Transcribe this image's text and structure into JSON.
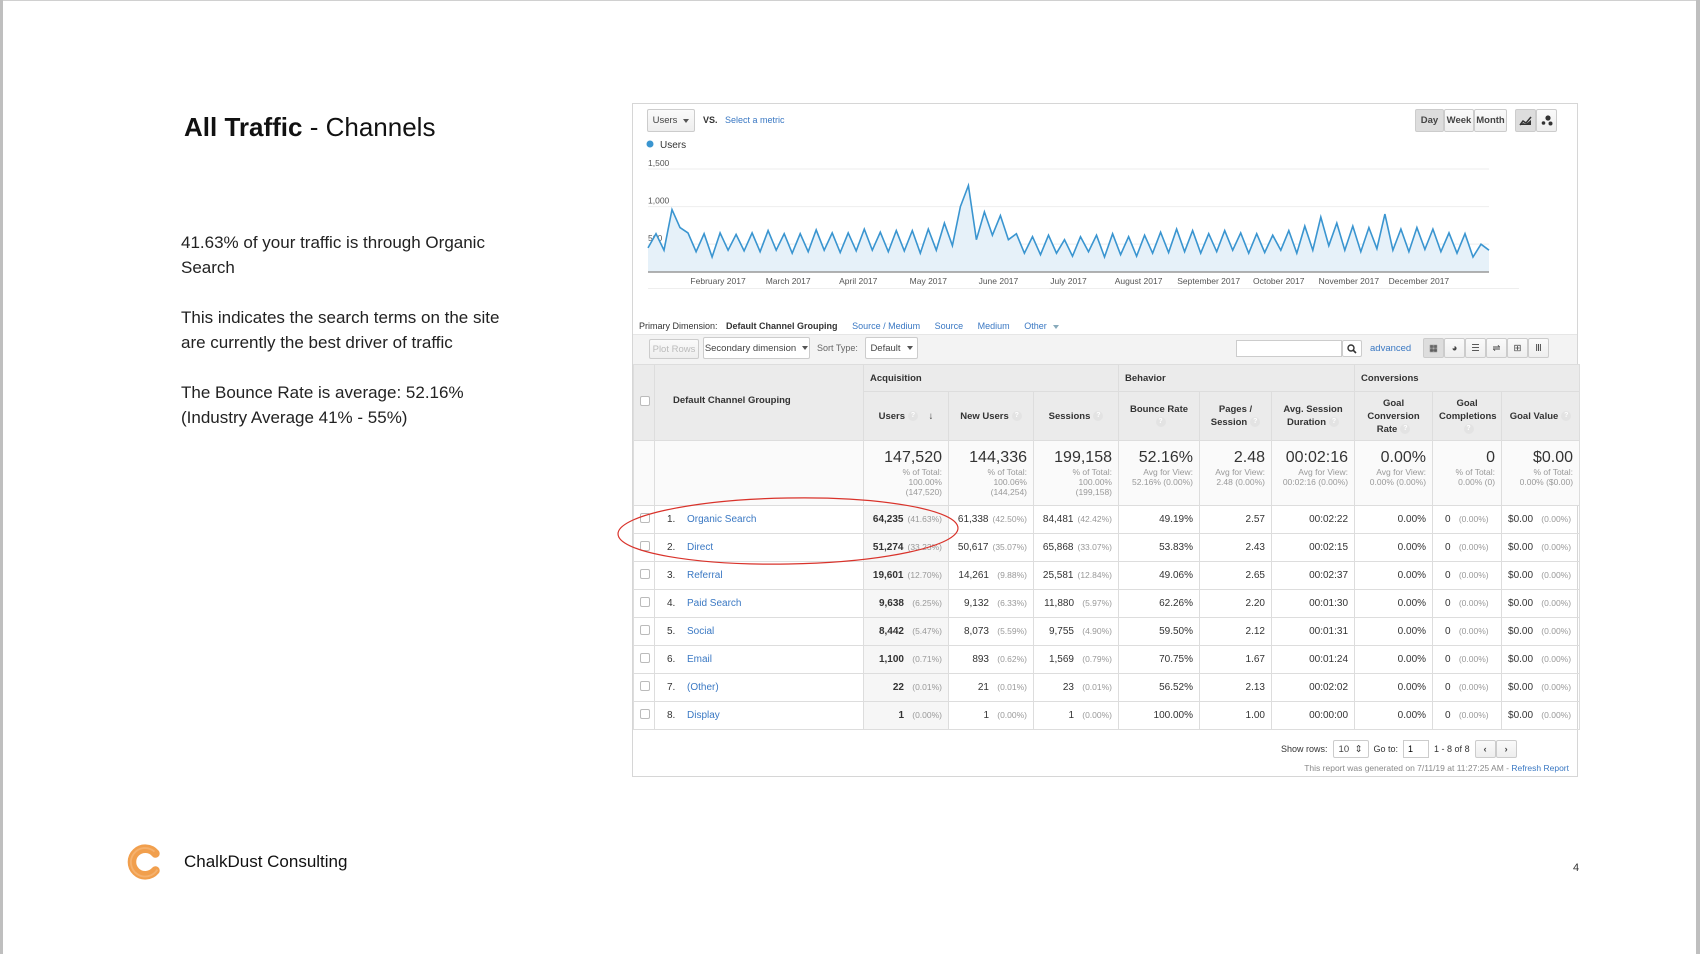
{
  "slide": {
    "title_bold": "All Traffic",
    "title_rest": " - Channels",
    "paragraphs": [
      "41.63% of your traffic is through Organic Search",
      "This indicates the search terms on the site are currently the best driver of traffic",
      "The Bounce Rate is average: 52.16% (Industry Average 41% - 55%)"
    ],
    "brand": "ChalkDust Consulting",
    "page_number": "4",
    "logo_color": "#f0953a",
    "annotation_color": "#d9332b"
  },
  "report": {
    "metric_select": "Users",
    "vs": "VS.",
    "select_metric": "Select a metric",
    "period_buttons": [
      "Day",
      "Week",
      "Month"
    ],
    "active_period": "Day",
    "chart_type_icons": [
      "line-chart-icon",
      "motion-chart-icon"
    ],
    "primary_dimension_label": "Primary Dimension:",
    "primary_dimension": "Default Channel Grouping",
    "dimension_links": [
      "Source / Medium",
      "Source",
      "Medium",
      "Other"
    ],
    "plot_rows": "Plot Rows",
    "secondary_dimension": "Secondary dimension",
    "sort_type_label": "Sort Type:",
    "sort_type": "Default",
    "search_value": "",
    "advanced": "advanced",
    "view_icons": [
      "grid-icon",
      "pie-icon",
      "bar-icon",
      "compare-icon",
      "pivot-icon",
      "term-cloud-icon"
    ],
    "show_rows_label": "Show rows:",
    "show_rows": "10",
    "goto_label": "Go to:",
    "goto_value": "1",
    "range": "1 - 8 of 8",
    "generated": "This report was generated on 7/11/19 at 11:27:25 AM - ",
    "refresh": "Refresh Report",
    "accent": "#3a78c3"
  },
  "chart_data": {
    "type": "area",
    "legend": [
      "Users"
    ],
    "series_color": "#3a95d0",
    "yticks": [
      "1,500",
      "1,000",
      "500"
    ],
    "ytick_values": [
      1500,
      1000,
      500
    ],
    "ylim": [
      130,
      1500
    ],
    "xticks": [
      "February 2017",
      "March 2017",
      "April 2017",
      "May 2017",
      "June 2017",
      "July 2017",
      "August 2017",
      "September 2017",
      "October 2017",
      "November 2017",
      "December 2017"
    ],
    "values": [
      450,
      640,
      420,
      960,
      720,
      650,
      400,
      640,
      330,
      650,
      420,
      630,
      410,
      650,
      400,
      680,
      420,
      640,
      380,
      640,
      400,
      690,
      420,
      650,
      390,
      650,
      410,
      700,
      420,
      660,
      400,
      680,
      410,
      680,
      380,
      700,
      420,
      780,
      480,
      1000,
      1280,
      560,
      930,
      620,
      880,
      560,
      640,
      380,
      600,
      360,
      620,
      380,
      560,
      340,
      600,
      400,
      620,
      330,
      640,
      360,
      600,
      340,
      620,
      380,
      660,
      390,
      700,
      400,
      680,
      380,
      640,
      400,
      680,
      420,
      650,
      380,
      640,
      390,
      620,
      420,
      680,
      380,
      740,
      420,
      860,
      480,
      780,
      420,
      740,
      400,
      720,
      440,
      900,
      420,
      700,
      400,
      720,
      430,
      700,
      400,
      650,
      380,
      640,
      330,
      500,
      420
    ]
  },
  "table": {
    "dimension_header": "Default Channel Grouping",
    "groups": [
      "Acquisition",
      "Behavior",
      "Conversions"
    ],
    "columns": [
      "Users",
      "New Users",
      "Sessions",
      "Bounce Rate",
      "Pages / Session",
      "Avg. Session Duration",
      "Goal Conversion Rate",
      "Goal Completions",
      "Goal Value"
    ],
    "totals": [
      {
        "value": "147,520",
        "l1": "% of Total:",
        "l2": "100.00%",
        "l3": "(147,520)"
      },
      {
        "value": "144,336",
        "l1": "% of Total:",
        "l2": "100.06%",
        "l3": "(144,254)"
      },
      {
        "value": "199,158",
        "l1": "% of Total:",
        "l2": "100.00%",
        "l3": "(199,158)"
      },
      {
        "value": "52.16%",
        "l1": "Avg for View:",
        "l2": "52.16% (0.00%)",
        "l3": ""
      },
      {
        "value": "2.48",
        "l1": "Avg for View:",
        "l2": "2.48 (0.00%)",
        "l3": ""
      },
      {
        "value": "00:02:16",
        "l1": "Avg for View:",
        "l2": "00:02:16 (0.00%)",
        "l3": ""
      },
      {
        "value": "0.00%",
        "l1": "Avg for View:",
        "l2": "0.00% (0.00%)",
        "l3": ""
      },
      {
        "value": "0",
        "l1": "% of Total:",
        "l2": "0.00% (0)",
        "l3": ""
      },
      {
        "value": "$0.00",
        "l1": "% of Total:",
        "l2": "0.00% ($0.00)",
        "l3": ""
      }
    ],
    "rows": [
      {
        "n": "1.",
        "name": "Organic Search",
        "users": "64,235",
        "users_pct": "(41.63%)",
        "new_users": "61,338",
        "new_users_pct": "(42.50%)",
        "sessions": "84,481",
        "sessions_pct": "(42.42%)",
        "bounce": "49.19%",
        "pages": "2.57",
        "duration": "00:02:22",
        "gcr": "0.00%",
        "gc": "0",
        "gc_pct": "(0.00%)",
        "gv": "$0.00",
        "gv_pct": "(0.00%)"
      },
      {
        "n": "2.",
        "name": "Direct",
        "users": "51,274",
        "users_pct": "(33.23%)",
        "new_users": "50,617",
        "new_users_pct": "(35.07%)",
        "sessions": "65,868",
        "sessions_pct": "(33.07%)",
        "bounce": "53.83%",
        "pages": "2.43",
        "duration": "00:02:15",
        "gcr": "0.00%",
        "gc": "0",
        "gc_pct": "(0.00%)",
        "gv": "$0.00",
        "gv_pct": "(0.00%)"
      },
      {
        "n": "3.",
        "name": "Referral",
        "users": "19,601",
        "users_pct": "(12.70%)",
        "new_users": "14,261",
        "new_users_pct": "(9.88%)",
        "sessions": "25,581",
        "sessions_pct": "(12.84%)",
        "bounce": "49.06%",
        "pages": "2.65",
        "duration": "00:02:37",
        "gcr": "0.00%",
        "gc": "0",
        "gc_pct": "(0.00%)",
        "gv": "$0.00",
        "gv_pct": "(0.00%)"
      },
      {
        "n": "4.",
        "name": "Paid Search",
        "users": "9,638",
        "users_pct": "(6.25%)",
        "new_users": "9,132",
        "new_users_pct": "(6.33%)",
        "sessions": "11,880",
        "sessions_pct": "(5.97%)",
        "bounce": "62.26%",
        "pages": "2.20",
        "duration": "00:01:30",
        "gcr": "0.00%",
        "gc": "0",
        "gc_pct": "(0.00%)",
        "gv": "$0.00",
        "gv_pct": "(0.00%)"
      },
      {
        "n": "5.",
        "name": "Social",
        "users": "8,442",
        "users_pct": "(5.47%)",
        "new_users": "8,073",
        "new_users_pct": "(5.59%)",
        "sessions": "9,755",
        "sessions_pct": "(4.90%)",
        "bounce": "59.50%",
        "pages": "2.12",
        "duration": "00:01:31",
        "gcr": "0.00%",
        "gc": "0",
        "gc_pct": "(0.00%)",
        "gv": "$0.00",
        "gv_pct": "(0.00%)"
      },
      {
        "n": "6.",
        "name": "Email",
        "users": "1,100",
        "users_pct": "(0.71%)",
        "new_users": "893",
        "new_users_pct": "(0.62%)",
        "sessions": "1,569",
        "sessions_pct": "(0.79%)",
        "bounce": "70.75%",
        "pages": "1.67",
        "duration": "00:01:24",
        "gcr": "0.00%",
        "gc": "0",
        "gc_pct": "(0.00%)",
        "gv": "$0.00",
        "gv_pct": "(0.00%)"
      },
      {
        "n": "7.",
        "name": "(Other)",
        "users": "22",
        "users_pct": "(0.01%)",
        "new_users": "21",
        "new_users_pct": "(0.01%)",
        "sessions": "23",
        "sessions_pct": "(0.01%)",
        "bounce": "56.52%",
        "pages": "2.13",
        "duration": "00:02:02",
        "gcr": "0.00%",
        "gc": "0",
        "gc_pct": "(0.00%)",
        "gv": "$0.00",
        "gv_pct": "(0.00%)"
      },
      {
        "n": "8.",
        "name": "Display",
        "users": "1",
        "users_pct": "(0.00%)",
        "new_users": "1",
        "new_users_pct": "(0.00%)",
        "sessions": "1",
        "sessions_pct": "(0.00%)",
        "bounce": "100.00%",
        "pages": "1.00",
        "duration": "00:00:00",
        "gcr": "0.00%",
        "gc": "0",
        "gc_pct": "(0.00%)",
        "gv": "$0.00",
        "gv_pct": "(0.00%)"
      }
    ]
  }
}
